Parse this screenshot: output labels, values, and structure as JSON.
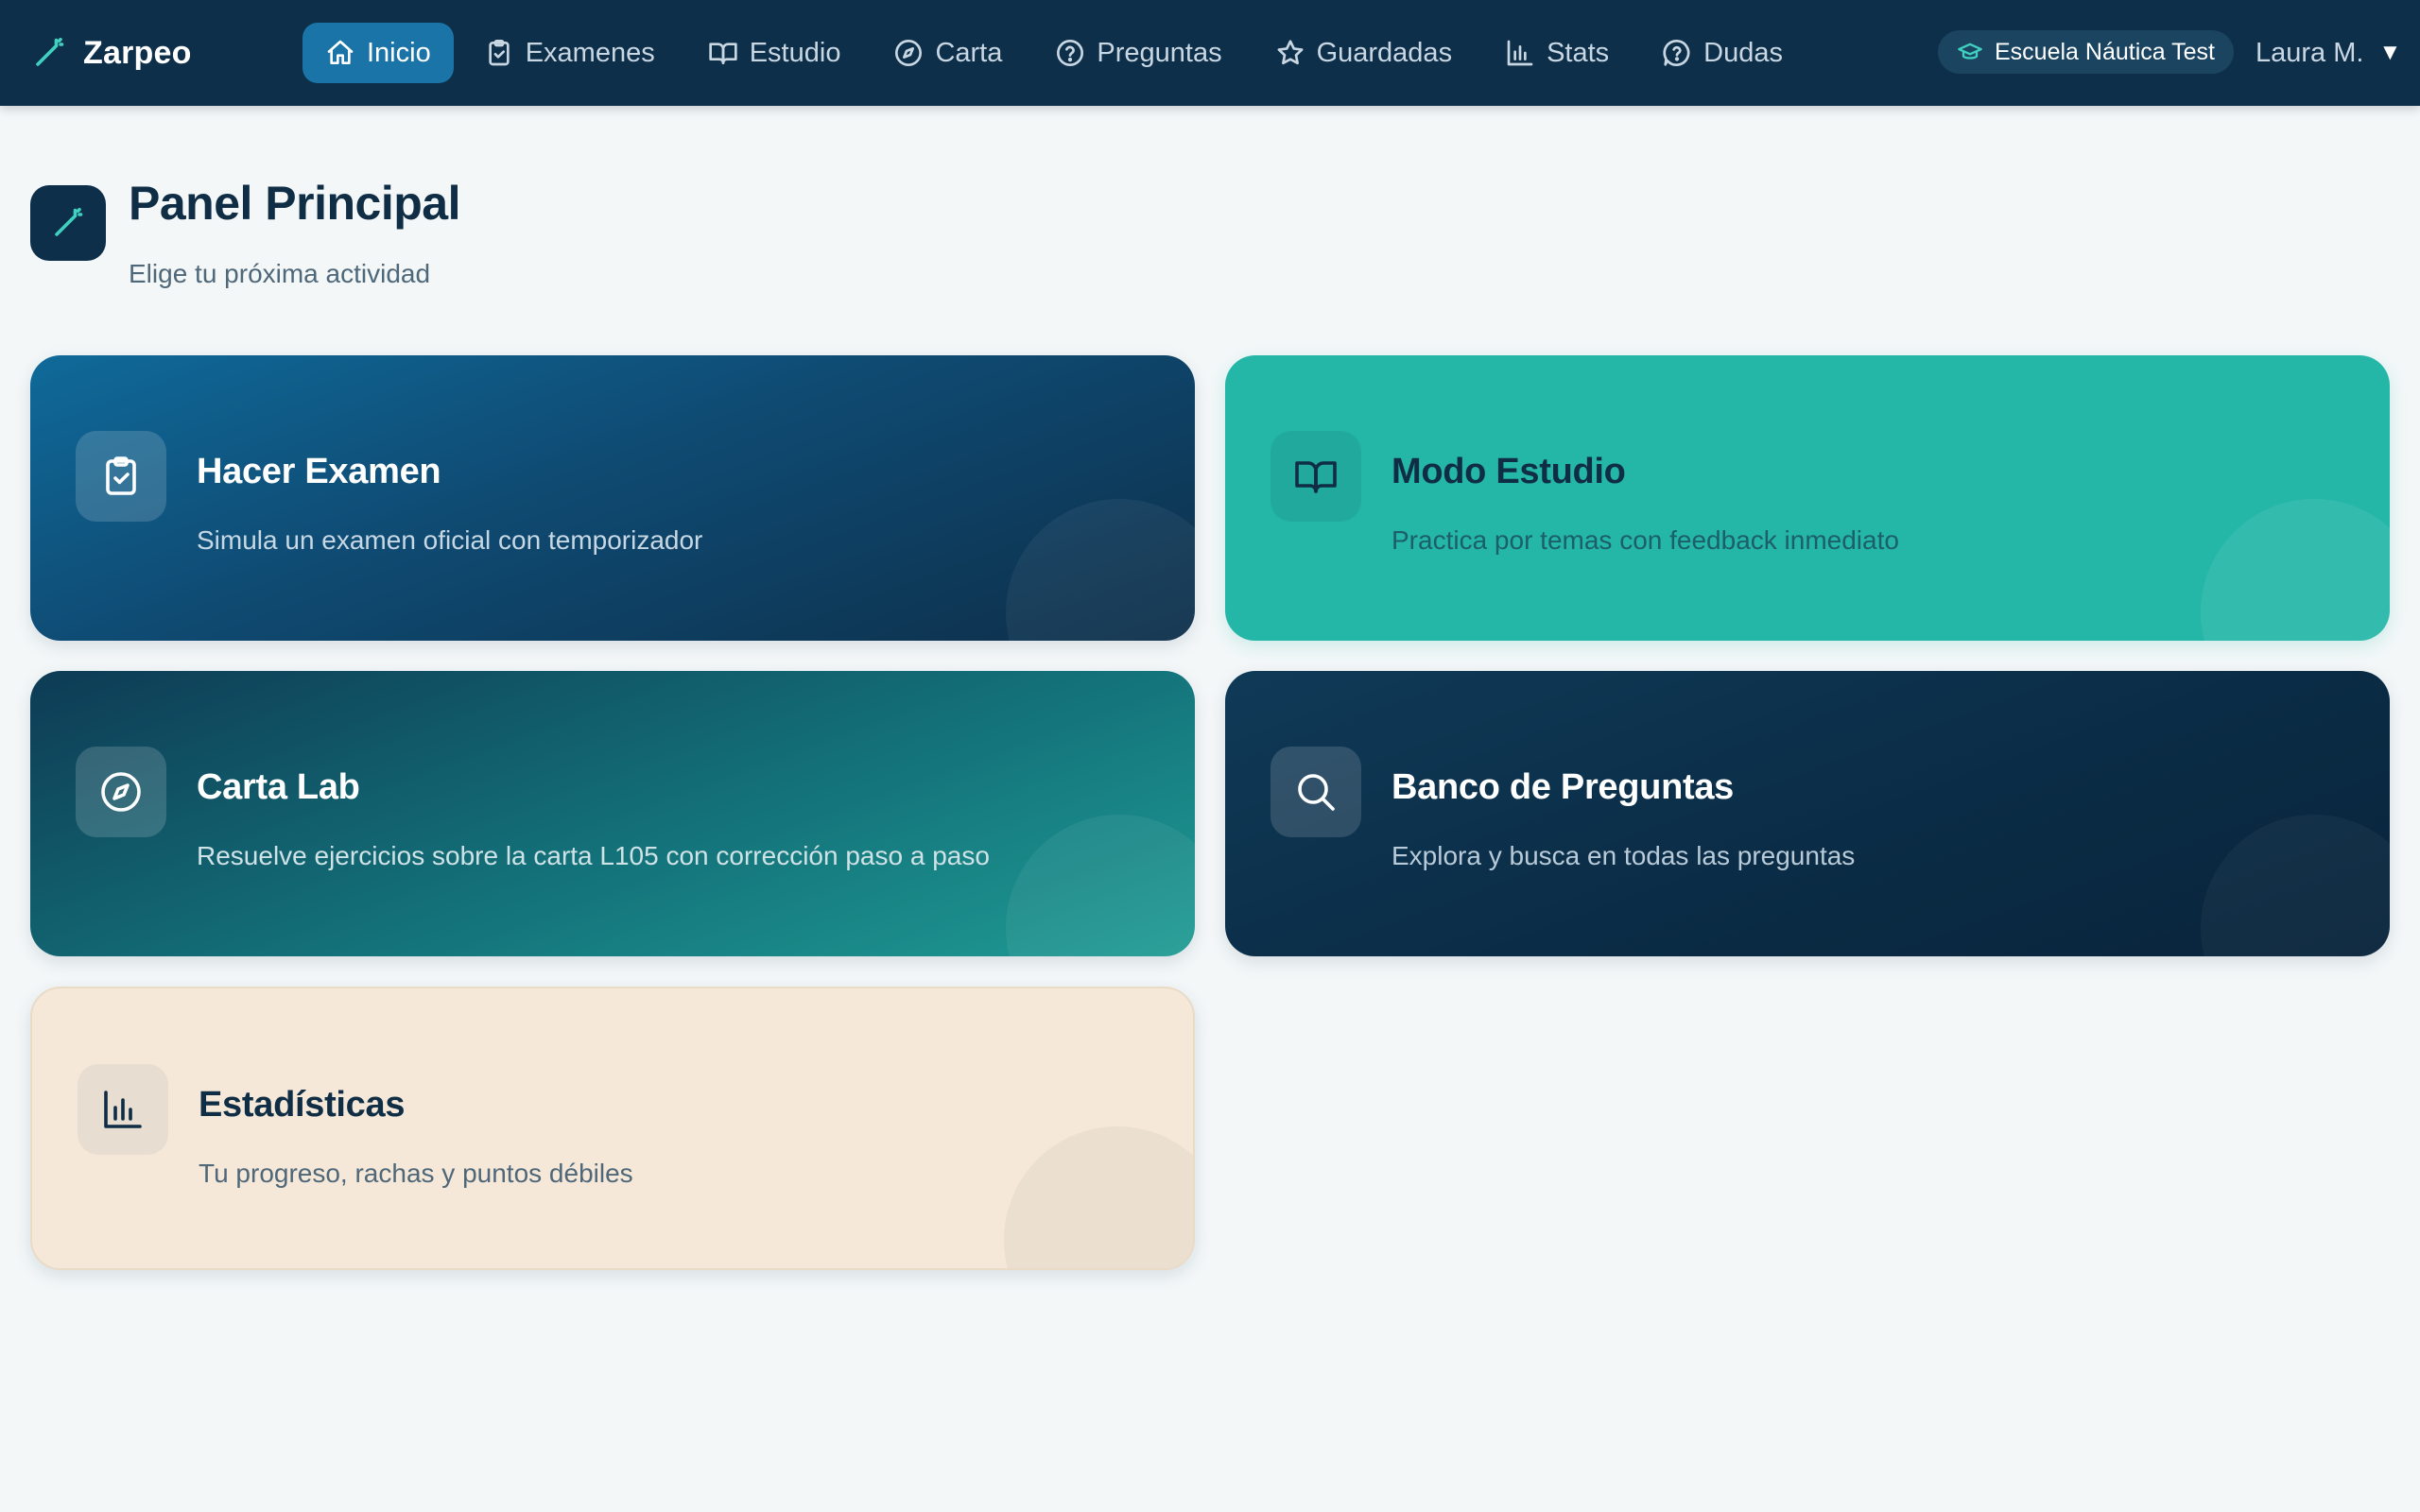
{
  "app": {
    "name": "Zarpeo",
    "colors": {
      "nav_bg": "#0d2f4a",
      "nav_active": "#1a74a8",
      "accent_teal": "#24b7a8",
      "page_bg": "#f3f7f8"
    }
  },
  "nav": {
    "items": [
      {
        "label": "Inicio",
        "icon": "home-icon",
        "active": true
      },
      {
        "label": "Examenes",
        "icon": "clipboard-check-icon",
        "active": false
      },
      {
        "label": "Estudio",
        "icon": "book-open-icon",
        "active": false
      },
      {
        "label": "Carta",
        "icon": "compass-icon",
        "active": false
      },
      {
        "label": "Preguntas",
        "icon": "help-circle-icon",
        "active": false
      },
      {
        "label": "Guardadas",
        "icon": "star-icon",
        "active": false
      },
      {
        "label": "Stats",
        "icon": "bar-chart-icon",
        "active": false
      },
      {
        "label": "Dudas",
        "icon": "message-question-icon",
        "active": false
      }
    ]
  },
  "school_badge": {
    "label": "Escuela Náutica Test",
    "icon": "graduation-cap-icon"
  },
  "user": {
    "name": "Laura M.",
    "caret": "▼"
  },
  "page": {
    "title": "Panel Principal",
    "subtitle": "Elige tu próxima actividad",
    "icon": "wand-icon"
  },
  "cards": [
    {
      "title": "Hacer Examen",
      "description": "Simula un examen oficial con temporizador",
      "icon": "clipboard-check-icon"
    },
    {
      "title": "Modo Estudio",
      "description": "Practica por temas con feedback inmediato",
      "icon": "book-open-icon"
    },
    {
      "title": "Carta Lab",
      "description": "Resuelve ejercicios sobre la carta L105 con corrección paso a paso",
      "icon": "compass-icon"
    },
    {
      "title": "Banco de Preguntas",
      "description": "Explora y busca en todas las preguntas",
      "icon": "search-icon"
    },
    {
      "title": "Estadísticas",
      "description": "Tu progreso, rachas y puntos débiles",
      "icon": "bar-chart-icon"
    }
  ]
}
